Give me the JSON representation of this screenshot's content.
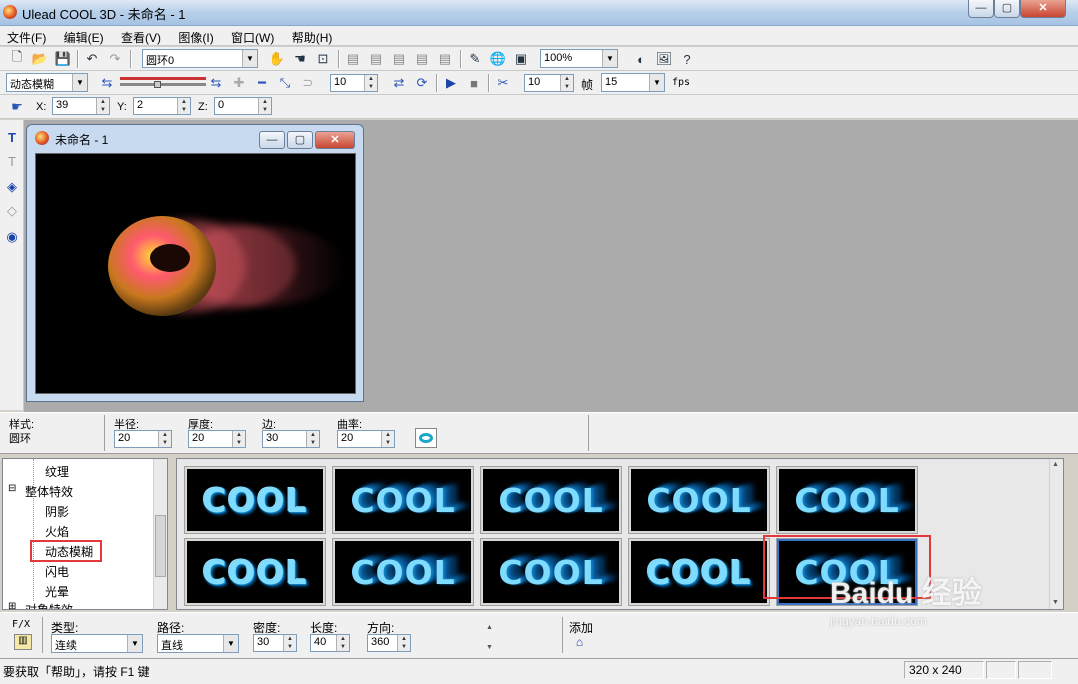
{
  "window": {
    "title": "Ulead COOL 3D - 未命名 - 1",
    "min": "—",
    "max": "▢",
    "close": "✕"
  },
  "menu": [
    "文件(F)",
    "编辑(E)",
    "查看(V)",
    "图像(I)",
    "窗口(W)",
    "帮助(H)"
  ],
  "toolbar1": {
    "object_combo": "圆环0",
    "zoom_combo": "100%"
  },
  "toolbar2": {
    "effect_combo": "动态模糊",
    "frame_spin": "10",
    "speed_spin": "10",
    "frames_label": "帧",
    "fps_combo": "15",
    "fps_label": "fps"
  },
  "position": {
    "x_label": "X:",
    "x_value": "39",
    "y_label": "Y:",
    "y_value": "2",
    "z_label": "Z:",
    "z_value": "0"
  },
  "document": {
    "title": "未命名 - 1"
  },
  "props": {
    "style_label": "样式:",
    "style_value": "圆环",
    "radius_label": "半径:",
    "radius_value": "20",
    "thickness_label": "厚度:",
    "thickness_value": "20",
    "edge_label": "边:",
    "edge_value": "30",
    "curve_label": "曲率:",
    "curve_value": "20"
  },
  "tree": [
    {
      "label": "纹理"
    },
    {
      "label": "整体特效",
      "expander": "⊟"
    },
    {
      "label": "阴影"
    },
    {
      "label": "火焰"
    },
    {
      "label": "动态模糊"
    },
    {
      "label": "闪电"
    },
    {
      "label": "光晕"
    },
    {
      "label": "对象特效",
      "expander": "⊞"
    }
  ],
  "gallery": {
    "thumb_text": "COOL",
    "count": 10,
    "selected_index": 9
  },
  "fx": {
    "fx_label": "F/X",
    "type_label": "类型:",
    "type_value": "连续",
    "path_label": "路径:",
    "path_value": "直线",
    "density_label": "密度:",
    "density_value": "30",
    "length_label": "长度:",
    "length_value": "40",
    "direction_label": "方向:",
    "direction_value": "360",
    "add_label": "添加"
  },
  "status": {
    "hint": "要获取「帮助」，请按 F1 键",
    "size": "320 x 240"
  },
  "watermark": {
    "brand": "Baidu 经验",
    "url": "jingyan.baidu.com"
  }
}
